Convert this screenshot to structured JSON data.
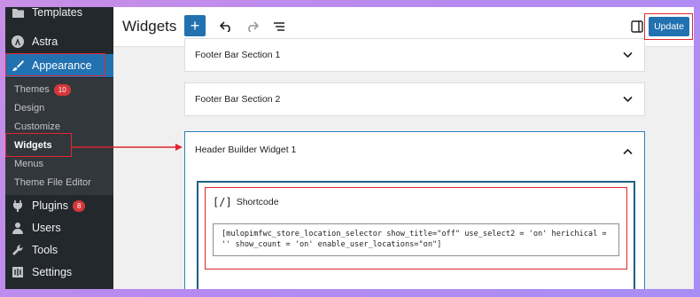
{
  "sidebar": {
    "items": [
      {
        "label": "Templates"
      },
      {
        "label": "Astra"
      },
      {
        "label": "Appearance"
      },
      {
        "label": "Plugins",
        "badge": "8"
      },
      {
        "label": "Users"
      },
      {
        "label": "Tools"
      },
      {
        "label": "Settings"
      }
    ],
    "submenu": [
      {
        "label": "Themes",
        "badge": "10"
      },
      {
        "label": "Design"
      },
      {
        "label": "Customize"
      },
      {
        "label": "Widgets"
      },
      {
        "label": "Menus"
      },
      {
        "label": "Theme File Editor"
      }
    ]
  },
  "header": {
    "title": "Widgets",
    "update_label": "Update"
  },
  "panels": {
    "footer1": "Footer Bar Section 1",
    "footer2": "Footer Bar Section 2",
    "header_widget": "Header Builder Widget 1"
  },
  "shortcode": {
    "label": "Shortcode",
    "icon_text": "[/]",
    "value": "[mulopimfwc_store_location_selector show_title=\"off\" use_select2 = 'on' herichical = '' show_count = 'on' enable_user_locations=\"on\"]"
  },
  "colors": {
    "accent": "#2271b1",
    "sidebar_bg": "#23282d",
    "highlight_red": "#e0262d",
    "badge_red": "#d63638"
  }
}
